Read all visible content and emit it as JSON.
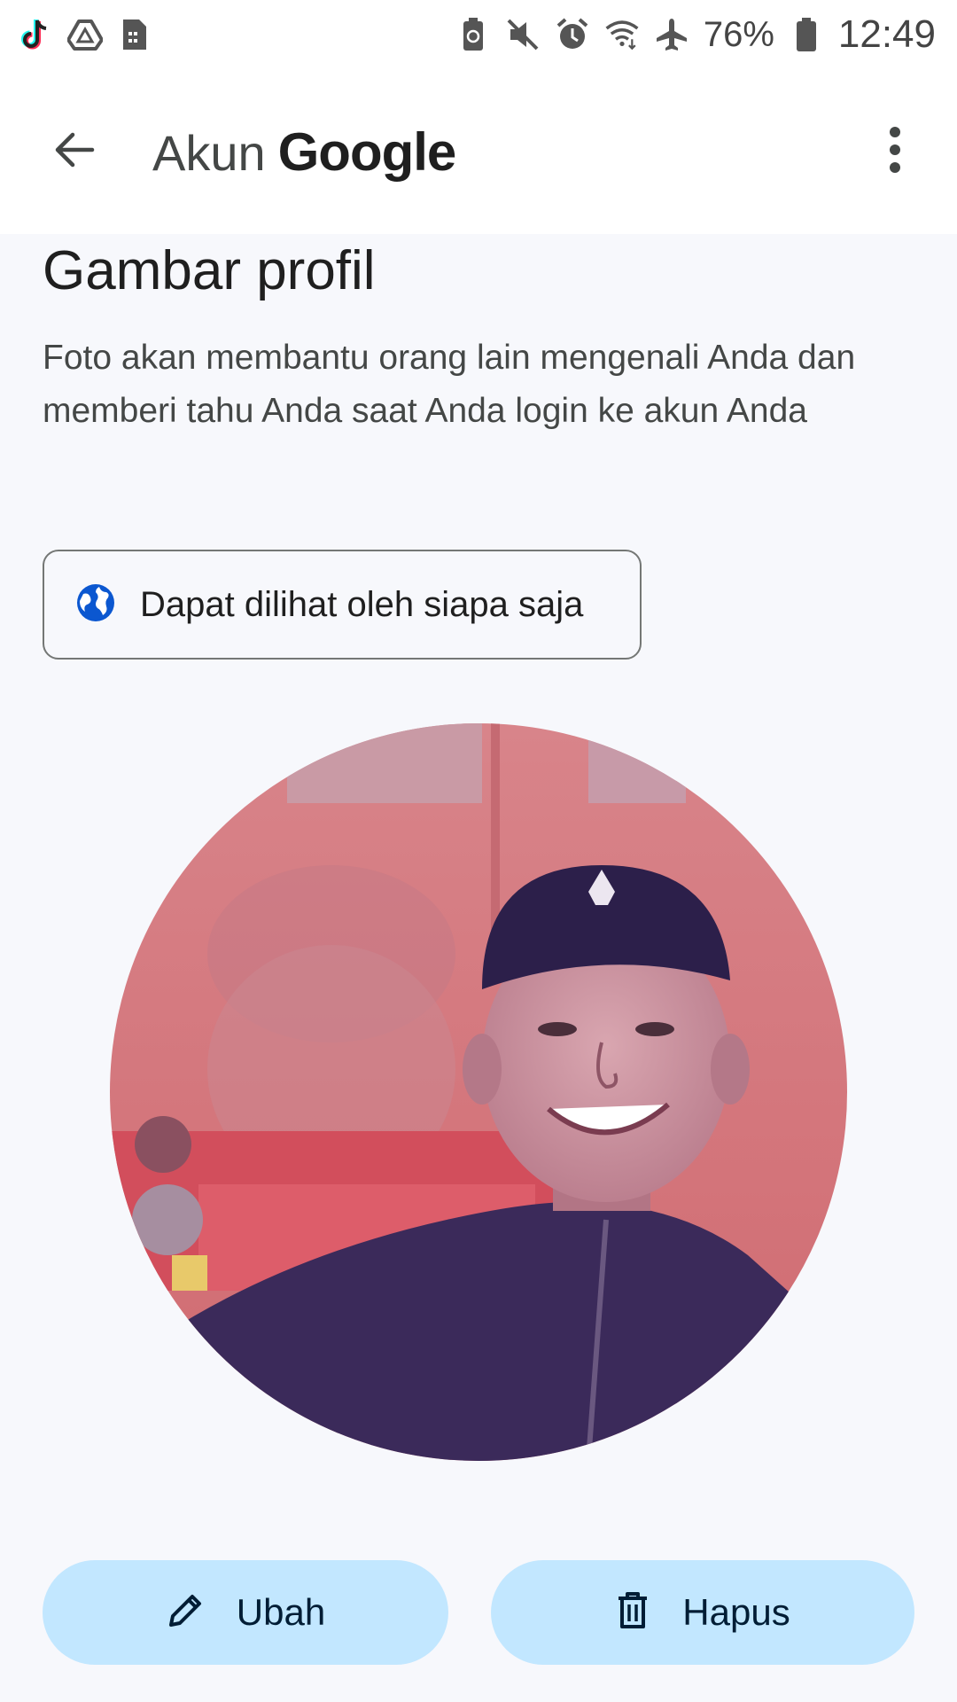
{
  "status_bar": {
    "left_icons": [
      "tiktok-icon",
      "drive-icon",
      "sim-icon"
    ],
    "right_icons": [
      "battery-saver-icon",
      "mute-icon",
      "alarm-icon",
      "wifi-icon",
      "airplane-icon",
      "battery-icon"
    ],
    "battery": "76%",
    "time": "12:49"
  },
  "app_bar": {
    "title_prefix": "Akun",
    "title_brand": "Google",
    "back_icon": "arrow-back-icon",
    "menu_icon": "more-vert-icon"
  },
  "main": {
    "title": "Gambar profil",
    "description": "Foto akan membantu orang lain mengenali Anda dan memberi tahu Anda saat Anda login ke akun Anda",
    "visibility": {
      "icon": "globe-icon",
      "label": "Dapat dilihat oleh siapa saja"
    }
  },
  "actions": {
    "edit": {
      "icon": "pencil-icon",
      "label": "Ubah"
    },
    "delete": {
      "icon": "trash-icon",
      "label": "Hapus"
    }
  },
  "colors": {
    "accent": "#0b57d0",
    "button_bg": "#c2e7ff",
    "background": "#f7f8fc"
  }
}
